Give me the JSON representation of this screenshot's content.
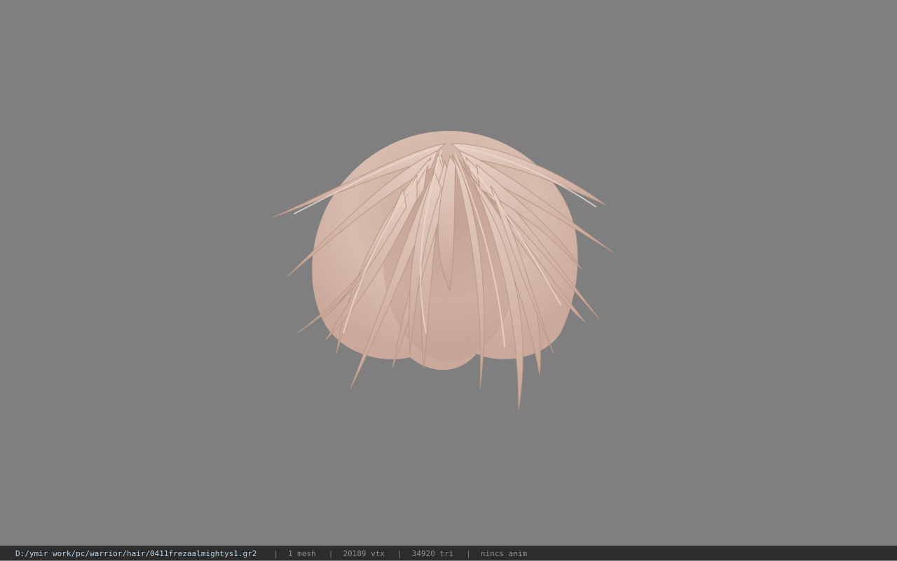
{
  "viewport": {
    "background_color": "#7f7f7f",
    "model": {
      "icon": "hair-mesh-render",
      "hair_color": "#d2b5a6"
    }
  },
  "statusbar": {
    "path": "D:/ymir work/pc/warrior/hair/0411frezaalmightys1.gr2",
    "separator": "|",
    "mesh": "1 mesh",
    "vertices": "20189 vtx",
    "triangles": "34920 tri",
    "anim": "nincs anim"
  }
}
